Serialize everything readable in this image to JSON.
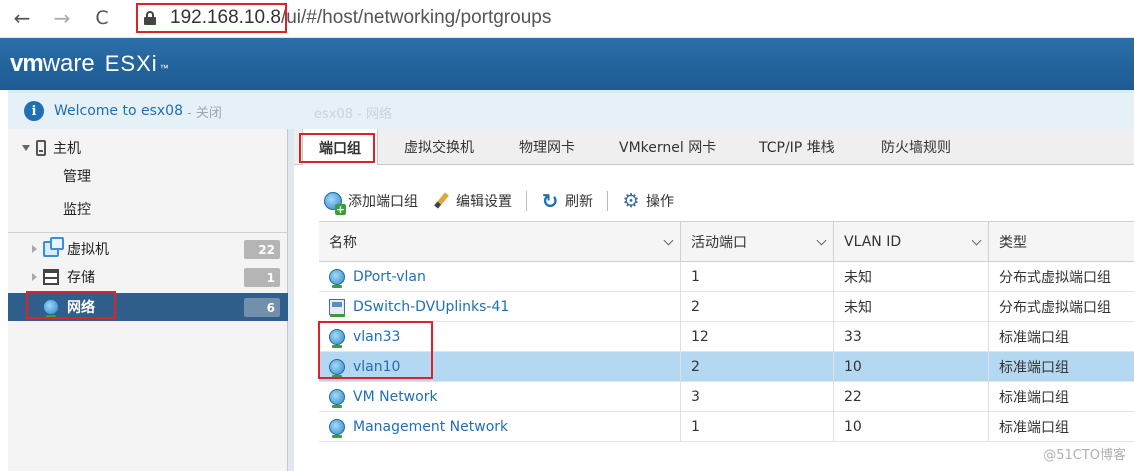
{
  "browser": {
    "back_icon": "←",
    "forward_icon": "→",
    "reload_icon": "C",
    "url_host": "192.168.10.8",
    "url_path": "/ui/#/host/networking/portgroups"
  },
  "header": {
    "logo_vm": "vm",
    "logo_ware": "ware",
    "product": "ESXi",
    "tm": "™"
  },
  "welcome": {
    "icon": "i",
    "text": "Welcome to esx08",
    "close": "- 关闭",
    "ghost": "esx08 - 网络"
  },
  "sidebar": {
    "host_label": "主机",
    "host_sub": [
      "管理",
      "监控"
    ],
    "items": [
      {
        "label": "虚拟机",
        "count": "22",
        "icon": "vm-icon"
      },
      {
        "label": "存储",
        "count": "1",
        "icon": "storage-icon"
      },
      {
        "label": "网络",
        "count": "6",
        "icon": "network-icon",
        "active": true
      }
    ]
  },
  "tabs": [
    {
      "label": "端口组",
      "active": true
    },
    {
      "label": "虚拟交换机"
    },
    {
      "label": "物理网卡"
    },
    {
      "label": "VMkernel 网卡"
    },
    {
      "label": "TCP/IP 堆栈"
    },
    {
      "label": "防火墙规则"
    }
  ],
  "toolbar": {
    "add_label": "添加端口组",
    "edit_label": "编辑设置",
    "refresh_label": "刷新",
    "actions_label": "操作"
  },
  "table": {
    "columns": [
      "名称",
      "活动端口",
      "VLAN ID",
      "类型"
    ],
    "rows": [
      {
        "name": "DPort-vlan",
        "ports": "1",
        "vlan": "未知",
        "type": "分布式虚拟端口组",
        "icon": "globe"
      },
      {
        "name": "DSwitch-DVUplinks-41",
        "ports": "2",
        "vlan": "未知",
        "type": "分布式虚拟端口组",
        "icon": "dvs"
      },
      {
        "name": "vlan33",
        "ports": "12",
        "vlan": "33",
        "type": "标准端口组",
        "icon": "globe"
      },
      {
        "name": "vlan10",
        "ports": "2",
        "vlan": "10",
        "type": "标准端口组",
        "icon": "globe",
        "selected": true
      },
      {
        "name": "VM Network",
        "ports": "3",
        "vlan": "22",
        "type": "标准端口组",
        "icon": "globe"
      },
      {
        "name": "Management Network",
        "ports": "1",
        "vlan": "10",
        "type": "标准端口组",
        "icon": "globe"
      }
    ]
  },
  "watermark": "@51CTO博客",
  "colors": {
    "header": "#2b6ea8",
    "highlight": "#d9252a",
    "selected_row": "#b5d8f2",
    "sidebar_active": "#315f8b"
  }
}
